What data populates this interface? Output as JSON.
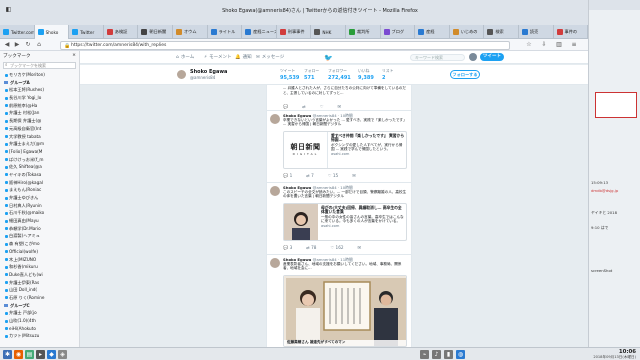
{
  "window": {
    "title": "Shoko Egawa(@amneris84)さん | Twitterからの返信付きツイート - Mozilla Firefox"
  },
  "tabs": [
    {
      "label": "Twitter.com",
      "color": "#1da1f2"
    },
    {
      "label": "Shoko",
      "color": "#1da1f2",
      "active": true
    },
    {
      "label": "Twitter",
      "color": "#1da1f2"
    },
    {
      "label": "あ検証",
      "color": "#d13c3c"
    },
    {
      "label": "朝日新聞",
      "color": "#444"
    },
    {
      "label": "オウム",
      "color": "#d18b2a"
    },
    {
      "label": "ライトル",
      "color": "#2a7ad1"
    },
    {
      "label": "産経ニュース",
      "color": "#2a7ad1"
    },
    {
      "label": "刑事事件",
      "color": "#d13c3c"
    },
    {
      "label": "NHK",
      "color": "#555"
    },
    {
      "label": "裁判所",
      "color": "#2a9d3a"
    },
    {
      "label": "ブログ",
      "color": "#7a4ad1"
    },
    {
      "label": "産経",
      "color": "#2a7ad1"
    },
    {
      "label": "いじめの",
      "color": "#d18b2a"
    },
    {
      "label": "検索",
      "color": "#555"
    },
    {
      "label": "読売",
      "color": "#2a7ad1"
    },
    {
      "label": "事件の",
      "color": "#d13c3c"
    }
  ],
  "nav": {
    "url": "https://twitter.com/amneris84/with_replies"
  },
  "sidebar": {
    "title": "ブックマーク",
    "close_icon": "×",
    "search_placeholder": "ブックマークを検索",
    "items": [
      {
        "label": "モリカケ(Moriton)",
        "type": "item"
      },
      {
        "label": "グループA",
        "type": "folder"
      },
      {
        "label": "松本王将(Rushes)",
        "type": "item"
      },
      {
        "label": "長谷川学 Yogi_lo",
        "type": "item"
      },
      {
        "label": "前原統幸(@Ha",
        "type": "item"
      },
      {
        "label": "弁護士 村松(Jan",
        "type": "item"
      },
      {
        "label": "長期保 弁護士(@",
        "type": "item"
      },
      {
        "label": "元高級自衛官(Int",
        "type": "item"
      },
      {
        "label": "大学教授 tabata",
        "type": "item"
      },
      {
        "label": "弁護士まえだ(@m",
        "type": "item"
      },
      {
        "label": "[Folio] Egawa(M",
        "type": "item"
      },
      {
        "label": "ばけけっお米(f_m",
        "type": "item"
      },
      {
        "label": "佐久 Shiftea(@a",
        "type": "item"
      },
      {
        "label": "ヤイキの(Tokasa",
        "type": "item"
      },
      {
        "label": "阪神Hiro(@kagal",
        "type": "item"
      },
      {
        "label": "まえもん(Roniac",
        "type": "item"
      },
      {
        "label": "弁護士ゆびきん",
        "type": "item"
      },
      {
        "label": "日村典人(Ryunin",
        "type": "item"
      },
      {
        "label": "石川千秋(@maiko",
        "type": "item"
      },
      {
        "label": "細田真由(Mayu",
        "type": "item"
      },
      {
        "label": "恭頼学(Dr.Mario",
        "type": "item"
      },
      {
        "label": "白渡製(ヘアミュ",
        "type": "item"
      },
      {
        "label": "森 有塑(こがmo",
        "type": "item"
      },
      {
        "label": "Official(wolfe)",
        "type": "item"
      },
      {
        "label": "木上(MIZUNO",
        "type": "item"
      },
      {
        "label": "和杉香(mikuru",
        "type": "item"
      },
      {
        "label": "Duke直人ども(wi",
        "type": "item"
      },
      {
        "label": "弁護士伊東(Ras",
        "type": "item"
      },
      {
        "label": "山田 Doll_ind(",
        "type": "item"
      },
      {
        "label": "石原 りく(Romine",
        "type": "item"
      },
      {
        "label": "グループC",
        "type": "folder"
      },
      {
        "label": "弁護士 戸部(jo",
        "type": "item"
      },
      {
        "label": "山吹(1.0)(4th",
        "type": "item"
      },
      {
        "label": "eiHi(Ahokuto",
        "type": "item"
      },
      {
        "label": "カツト(Mitsuzu",
        "type": "item"
      }
    ]
  },
  "twitter_nav": {
    "home": "ホーム",
    "moments": "モーメント",
    "notifications": "通知",
    "messages": "メッセージ",
    "search_placeholder": "キーワード検索",
    "tweet_button": "ツイート"
  },
  "profile": {
    "name": "Shoko Egawa",
    "handle": "@amneris84",
    "stats": [
      {
        "label": "ツイート",
        "value": "95,539"
      },
      {
        "label": "フォロー",
        "value": "571"
      },
      {
        "label": "フォロワー",
        "value": "272,491"
      },
      {
        "label": "いいね",
        "value": "9,389"
      },
      {
        "label": "リスト",
        "value": "2"
      }
    ],
    "follow_button": "フォローする"
  },
  "timeline": {
    "top_text": "... 弁護人とされた人が、さらに自分たちの公判に向けて準備をしているのだと、主張しているのに対してずっと... ",
    "tweets": [
      {
        "name": "Shoko Egawa",
        "meta": "@amneris84 · 10時間",
        "text": "卒業できないという言葉がよかった ... 愛すべき、実践で「楽しかったです」 ... 実習から帰国 | 朝日新聞デジタル",
        "card_title": "愛すべき仲間『楽しかったです』 実習から帰国…",
        "card_body": "ボクシングの愛した人すべてが、実行から帰国 ... 実践で学んで帰国したという。",
        "card_domain": "asahi.com",
        "card_logo": "朝日新聞",
        "card_logo_sub": "DIGITAL",
        "replies": "1",
        "retweets": "7",
        "likes": "15"
      },
      {
        "name": "Shoko Egawa",
        "meta": "@amneris84 · 10時間",
        "text": "このスピーチの全文が読みたい。... 一部だけで目頭、警察離婚の人、高校生の体を置いた言葉 | 朝日新聞デジタル",
        "card_title": "母がの(大丈夫)回帰、異議取消し… 高卒生の全体置いた言葉",
        "card_body": "一般の中の女性の皆さんの言葉。高卒生ではこんなに来ている。今も多くの人が言葉をかけている。",
        "card_domain": "asahi.com",
        "replies": "3",
        "retweets": "78",
        "likes": "162"
      },
      {
        "name": "Shoko Egawa",
        "meta": "@amneris84 · 11時間",
        "text": "産業表彰者さん、地域の支援をお願いしてください。地域、事務局、関係者、地域社会に...",
        "card_caption": "佐藤美穂さん 誰遠先がすべてのマン"
      }
    ]
  },
  "right_window": {
    "items": [
      "15:09:13",
      "dmdb@dsjg.jp",
      "ヤイキと 2018",
      "9:10 はで",
      "screenShot"
    ]
  },
  "taskbar": {
    "time": "10:06",
    "date": "2018年09月13日(木曜日)"
  }
}
